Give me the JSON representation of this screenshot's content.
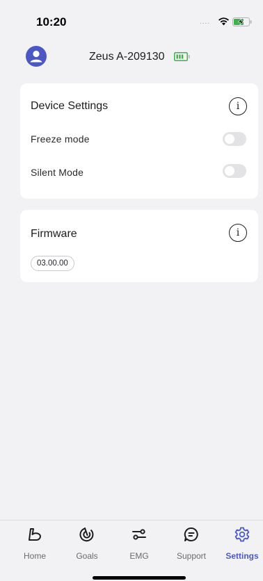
{
  "status_bar": {
    "time": "10:20",
    "signal_dots": "...."
  },
  "header": {
    "device_name": "Zeus A-209130"
  },
  "device_settings": {
    "title": "Device Settings",
    "rows": [
      {
        "label": "Freeze mode",
        "enabled": false
      },
      {
        "label": "Silent Mode",
        "enabled": false
      }
    ]
  },
  "firmware": {
    "title": "Firmware",
    "version": "03.00.00"
  },
  "tabbar": {
    "tabs": [
      {
        "label": "Home",
        "icon": "arm-flex-icon"
      },
      {
        "label": "Goals",
        "icon": "target-icon"
      },
      {
        "label": "EMG",
        "icon": "sliders-icon"
      },
      {
        "label": "Support",
        "icon": "chat-icon"
      },
      {
        "label": "Settings",
        "icon": "gear-icon",
        "active": true
      }
    ]
  },
  "colors": {
    "accent": "#4b58c4",
    "background": "#f2f2f4",
    "card": "#ffffff",
    "battery_green": "#3bb34a"
  }
}
